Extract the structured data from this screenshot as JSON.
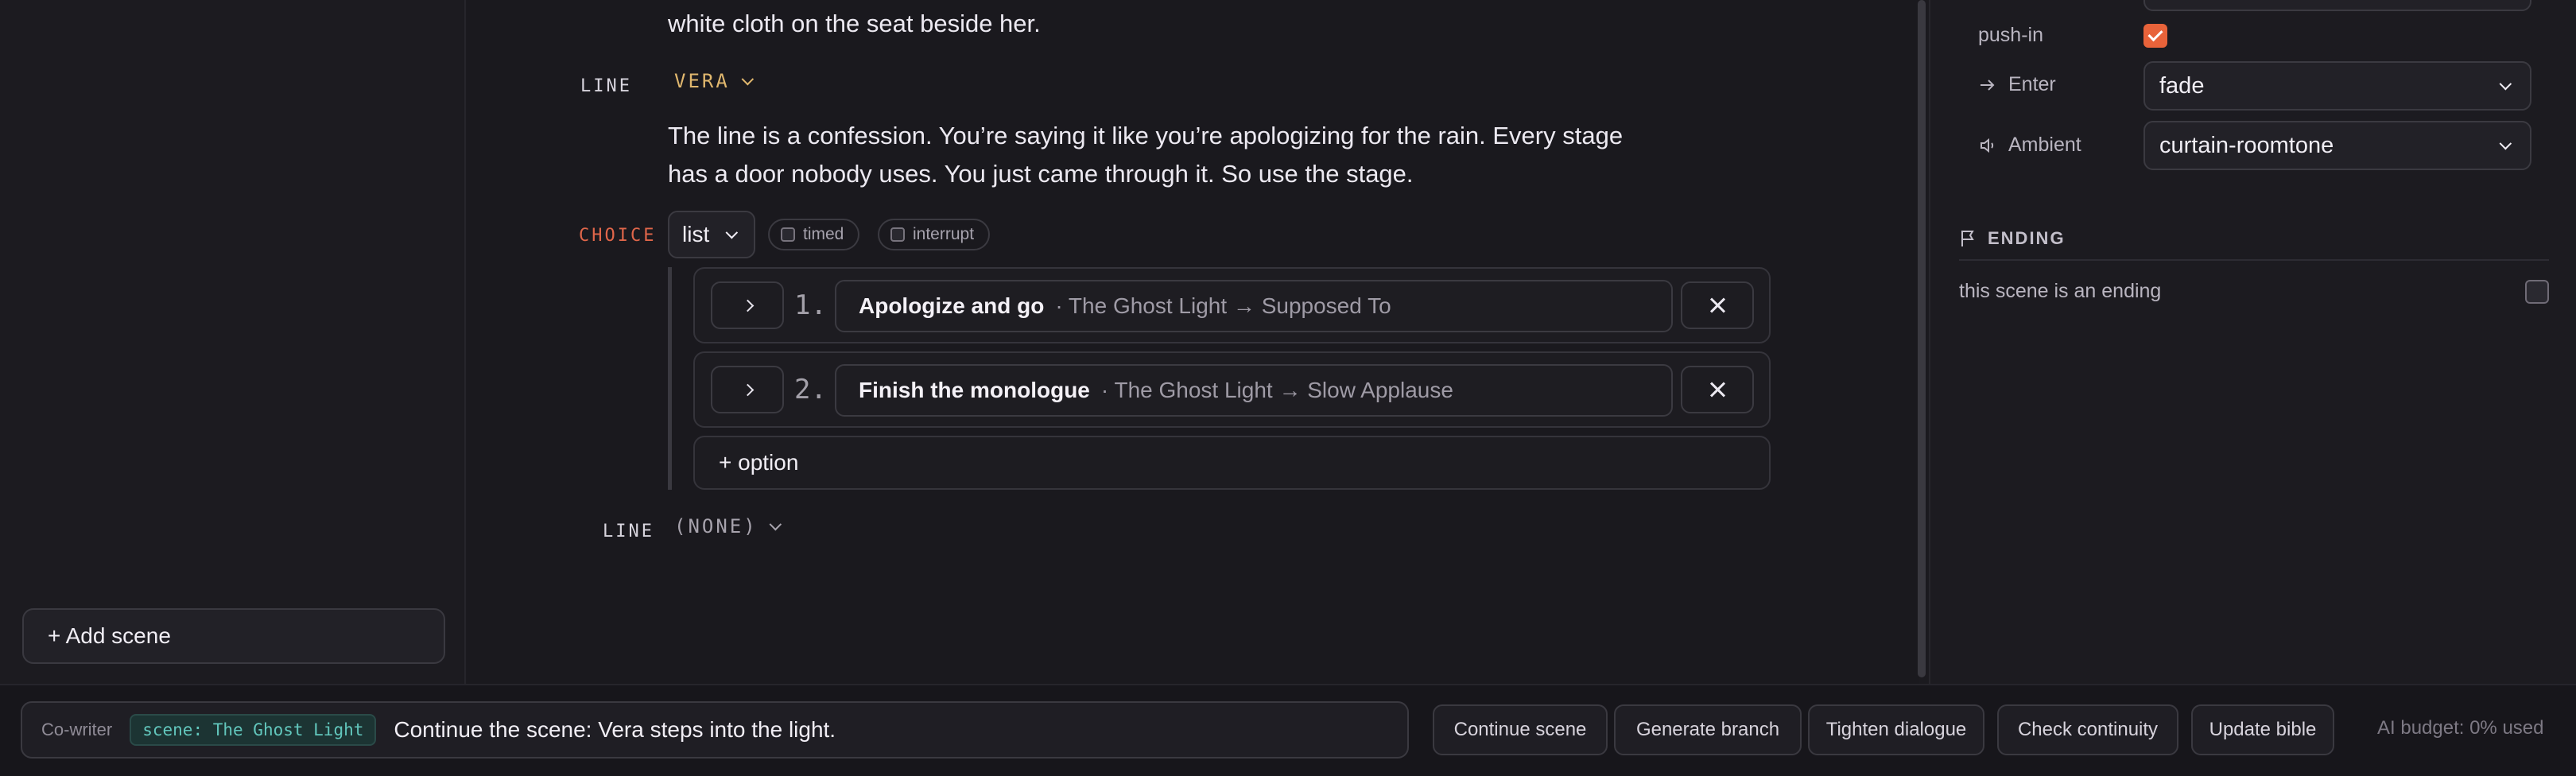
{
  "sidebar": {
    "add_scene_label": "+ Add scene"
  },
  "editor": {
    "prev_line_tail": "white cloth on the seat beside her.",
    "line1": {
      "tag": "LINE",
      "speaker": "VERA",
      "text_l1": "The line is a confession. You’re saying it like you’re apologizing for the rain. Every stage",
      "text_l2": "has a door nobody uses. You just came through it. So use the stage."
    },
    "choice": {
      "tag": "CHOICE",
      "mode": "list",
      "timed_label": "timed",
      "interrupt_label": "interrupt",
      "options": [
        {
          "number": "1.",
          "text": "Apologize and go",
          "target": "· The Ghost Light → Supposed To"
        },
        {
          "number": "2.",
          "text": "Finish the monologue",
          "target": "· The Ghost Light → Slow Applause"
        }
      ],
      "add_option_label": "+ option"
    },
    "line2": {
      "tag": "LINE",
      "speaker": "(NONE)"
    }
  },
  "right_panel": {
    "push_in_label": "push-in",
    "push_in_checked": true,
    "enter_label": "Enter",
    "enter_value": "fade",
    "ambient_label": "Ambient",
    "ambient_value": "curtain-roomtone",
    "ending_heading": "ENDING",
    "ending_text": "this scene is an ending",
    "ending_checked": false
  },
  "bottom_bar": {
    "cowriter_label": "Co-writer",
    "scene_chip": "scene: The Ghost Light",
    "input_text": "Continue the scene: Vera steps into the light.",
    "actions": [
      "Continue scene",
      "Generate branch",
      "Tighten dialogue",
      "Check continuity",
      "Update bible"
    ],
    "ai_budget": "AI budget: 0% used"
  },
  "colors": {
    "accent_orange": "#e8633a",
    "speaker_gold": "#e0b76e",
    "choice_red": "#e0664a",
    "chip_teal": "#62c7bd",
    "background": "#1a191e"
  }
}
